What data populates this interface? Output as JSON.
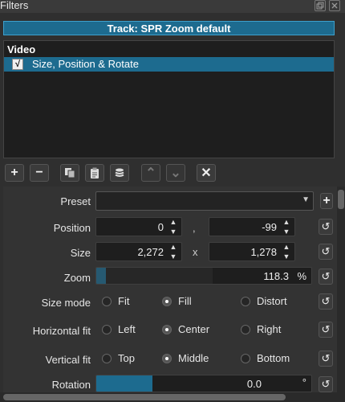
{
  "window": {
    "title": "Filters"
  },
  "track": {
    "label": "Track: SPR Zoom default"
  },
  "list": {
    "header": "Video",
    "items": [
      {
        "label": "Size, Position & Rotate",
        "checked": true,
        "check_glyph": "√"
      }
    ]
  },
  "toolbar": {
    "icons": [
      "add-icon",
      "remove-icon",
      "copy-icon",
      "paste-icon",
      "stack-icon",
      "move-up-icon",
      "move-down-icon",
      "deselect-icon"
    ],
    "glyphs": {
      "add": "+",
      "remove": "−",
      "up": "⌃",
      "down": "⌄",
      "close": "✕"
    }
  },
  "properties": {
    "preset": {
      "label": "Preset",
      "value": "",
      "add_glyph": "+"
    },
    "position": {
      "label": "Position",
      "x": "0",
      "separator": ",",
      "y": "-99"
    },
    "size": {
      "label": "Size",
      "w": "2,272",
      "separator": "x",
      "h": "1,278"
    },
    "zoom": {
      "label": "Zoom",
      "value": "118.3",
      "unit": "%",
      "fill_fraction": 0.012
    },
    "size_mode": {
      "label": "Size mode",
      "options": [
        "Fit",
        "Fill",
        "Distort"
      ],
      "selected": "Fill"
    },
    "horizontal_fit": {
      "label": "Horizontal fit",
      "options": [
        "Left",
        "Center",
        "Right"
      ],
      "selected": "Center"
    },
    "vertical_fit": {
      "label": "Vertical fit",
      "options": [
        "Top",
        "Middle",
        "Bottom"
      ],
      "selected": "Middle"
    },
    "rotation": {
      "label": "Rotation",
      "value": "0.0",
      "unit": "°",
      "fill_fraction": 0.26
    }
  },
  "colors": {
    "accent": "#1d6b8f",
    "background": "#2f2f2f",
    "field": "#1e1e1e"
  }
}
